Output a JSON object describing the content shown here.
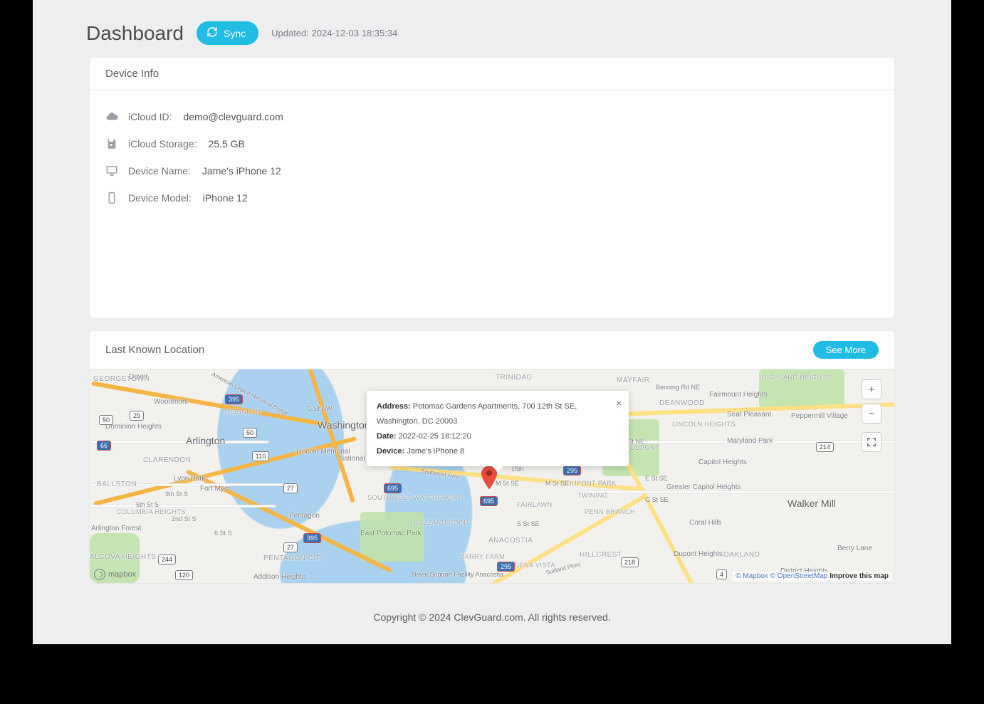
{
  "header": {
    "title": "Dashboard",
    "sync_label": "Sync",
    "updated_prefix": "Updated:",
    "updated_time": "2024-12-03 18:35:34"
  },
  "device_info": {
    "card_title": "Device Info",
    "icloud_id_label": "iCloud ID:",
    "icloud_id_value": "demo@clevguard.com",
    "icloud_storage_label": "iCloud Storage:",
    "icloud_storage_value": "25.5 GB",
    "device_name_label": "Device Name:",
    "device_name_value": "Jame's iPhone 12",
    "device_model_label": "Device Model:",
    "device_model_value": "iPhone 12"
  },
  "location": {
    "card_title": "Last Known Location",
    "see_more": "See More",
    "popup": {
      "address_label": "Address:",
      "address_value": "Potomac Gardens Apartments, 700 12th St SE, Washington, DC 20003",
      "date_label": "Date:",
      "date_value": "2022-02-25 18:12:20",
      "device_label": "Device:",
      "device_value": "Jame's iPhone 8"
    },
    "attribution": {
      "mapbox": "© Mapbox",
      "osm": "© OpenStreetMap",
      "improve": "Improve this map"
    },
    "logo_text": "mapbox",
    "labels": {
      "washington": "Washington",
      "arlington": "Arlington",
      "walker_mill": "Walker Mill",
      "georgetown": "GEORGETOWN",
      "rosslyn": "ROSSLYN",
      "clarendon": "CLARENDON",
      "ballston": "BALLSTON",
      "columbia_heights": "COLUMBIA HEIGHTS",
      "pentagon_city": "PENTAGON CITY",
      "alcova_heights": "ALCOVA HEIGHTS",
      "arlington_forest": "Arlington Forest",
      "dominion_heights": "Dominion Heights",
      "woodmont": "Woodmont",
      "dover": "Dover",
      "trinidad": "TRINIDAD",
      "mayfair": "MAYFAIR",
      "deanwood": "DEANWOOD",
      "lincoln_heights": "LINCOLN HEIGHTS",
      "fort_dupont": "FORT DUPONT",
      "capitol_heights": "Capitol Heights",
      "greater_capitol": "Greater Capitol Heights",
      "coral_hills": "Coral Hills",
      "dupont_park": "DUPONT PARK",
      "twining": "TWINING",
      "fairlawn": "FAIRLAWN",
      "penn_branch": "PENN BRANCH",
      "hillcrest": "HILLCREST",
      "anacostia": "ANACOSTIA",
      "barry_farm": "BARRY FARM",
      "buzzard_point": "BUZZARD POINT",
      "buena_vista": "BUENA VISTA",
      "sw_waterfront": "SOUTHWEST WATERFRONT",
      "east_potomac": "East Potomac Park",
      "lincoln_mem": "Lincoln Memorial",
      "national_mall": "National Ma",
      "oakland": "OAKLAND",
      "dupont_heights": "Dupont Heights",
      "district_heights": "District Heights",
      "berry_lane": "Berry Lane",
      "maryland_park": "Maryland Park",
      "fairmount_heights": "Fairmount Heights",
      "seat_pleasant": "Seat Pleasant",
      "peppermill": "Peppermill Village",
      "highland_heights": "HIGHLAND HEIGHTS",
      "pentagon": "Pentagon",
      "ft_myer": "Fort Myer",
      "addison_heights": "Addison Heights",
      "lyon_park": "Lyon Park",
      "naval_sup": "Naval Support Facility Anacostia",
      "g_st_nw": "G St NW",
      "m_st_se1": "M St SE",
      "m_st_se2": "M St SE",
      "s_st_se": "S St SE",
      "e_st_se": "E St SE",
      "g_st_se": "G St SE",
      "capitol_st": "Capitol St NE",
      "benning_rd": "Benning Rd NE",
      "american_legion": "American Legion Memorial Bridge",
      "suitland_pkwy": "Suitland Pkwy",
      "southeast_fwy": "Southeast Fwy",
      "second_st": "2nd St S",
      "ninth_st": "9th St S",
      "fifth_st": "5th St S",
      "fifteenth": "15th",
      "six_st": "6 St S"
    },
    "shields": {
      "r66": "66",
      "r50_1": "50",
      "r50_2": "50",
      "r29": "29",
      "r120": "120",
      "r244": "244",
      "r27_1": "27",
      "r27_2": "27",
      "r110": "110",
      "r395_1": "395",
      "r395_2": "395",
      "r695_1": "695",
      "r695_2": "695",
      "r295_1": "295",
      "r295_2": "295",
      "r218": "218",
      "r214": "214",
      "r4": "4"
    }
  },
  "footer": {
    "text": "Copyright © 2024 ClevGuard.com. All rights reserved."
  }
}
